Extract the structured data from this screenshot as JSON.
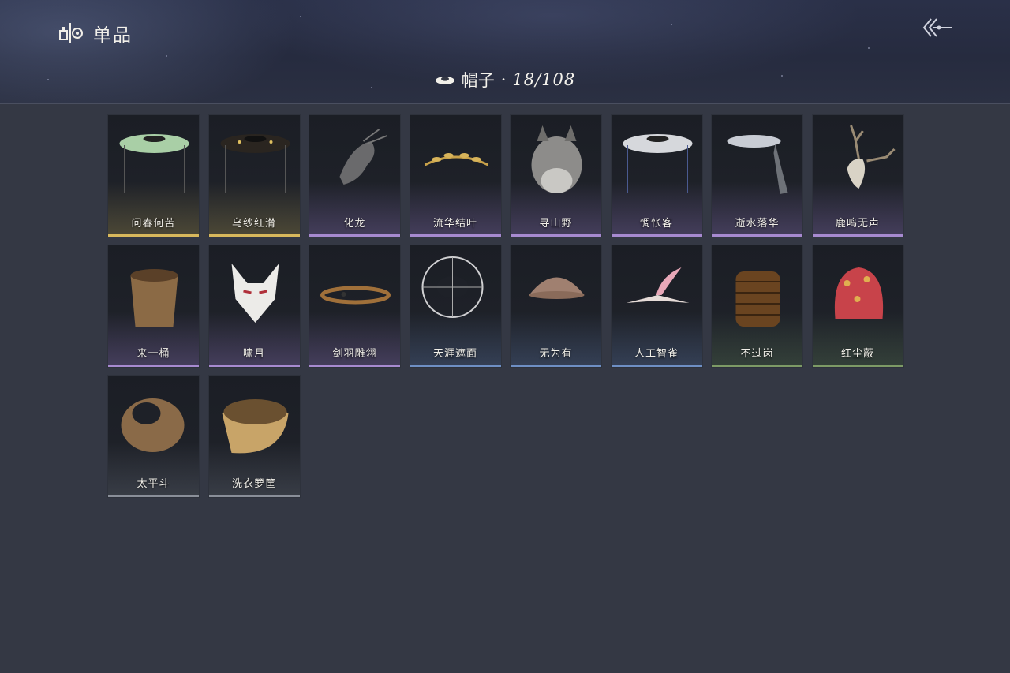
{
  "header": {
    "section_title": "单品",
    "section_icon": "wardrobe-icon",
    "back_icon": "back-arrow-icon"
  },
  "category": {
    "icon": "hat-icon",
    "name": "帽子",
    "separator": "·",
    "count": "18/108"
  },
  "colors": {
    "background": "#343844",
    "gold": "#d8b85c",
    "purple": "#a78ad0",
    "blue": "#6e8fc4",
    "green": "#7d9a66",
    "gray": "#8a8f99"
  },
  "items": [
    {
      "name": "问春何苦",
      "rarity": "gold",
      "icon": "green-bamboo-hat-icon"
    },
    {
      "name": "乌纱红潸",
      "rarity": "gold",
      "icon": "black-bamboo-hat-icon"
    },
    {
      "name": "化龙",
      "rarity": "purple",
      "icon": "dragon-headpiece-icon"
    },
    {
      "name": "流华结叶",
      "rarity": "purple",
      "icon": "laurel-crown-icon"
    },
    {
      "name": "寻山野",
      "rarity": "purple",
      "icon": "wolf-mask-icon"
    },
    {
      "name": "惆怅客",
      "rarity": "purple",
      "icon": "white-bamboo-hat-icon"
    },
    {
      "name": "逝水落华",
      "rarity": "purple",
      "icon": "veiled-hat-icon"
    },
    {
      "name": "鹿鸣无声",
      "rarity": "purple",
      "icon": "deer-skull-icon"
    },
    {
      "name": "来一桶",
      "rarity": "purple",
      "icon": "wooden-bucket-icon"
    },
    {
      "name": "啸月",
      "rarity": "purple",
      "icon": "fox-mask-icon"
    },
    {
      "name": "剑羽雕翎",
      "rarity": "purple",
      "icon": "headband-icon"
    },
    {
      "name": "天涯遮面",
      "rarity": "blue",
      "icon": "woven-hat-icon"
    },
    {
      "name": "无为有",
      "rarity": "blue",
      "icon": "clay-bowl-icon"
    },
    {
      "name": "人工智雀",
      "rarity": "blue",
      "icon": "bird-hat-icon"
    },
    {
      "name": "不过岗",
      "rarity": "green",
      "icon": "stacked-bowls-icon"
    },
    {
      "name": "红尘蔽",
      "rarity": "green",
      "icon": "red-cloth-hat-icon"
    },
    {
      "name": "太平斗",
      "rarity": "gray",
      "icon": "wicker-basket-icon"
    },
    {
      "name": "洗衣箩筐",
      "rarity": "gray",
      "icon": "laundry-basket-icon"
    }
  ]
}
